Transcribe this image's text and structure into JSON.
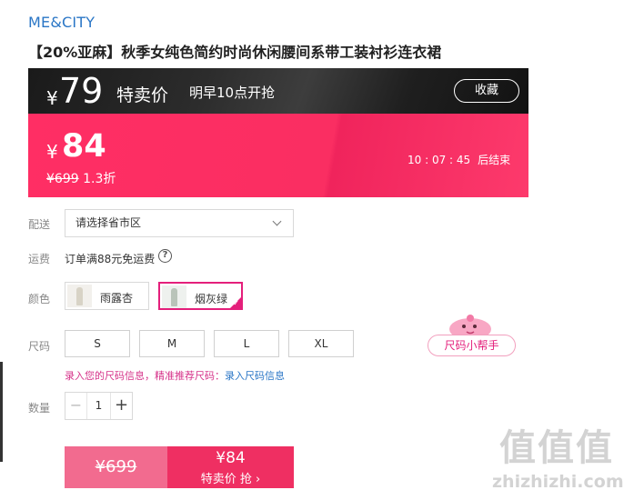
{
  "brand": "ME&CITY",
  "product_title": "【20%亚麻】秋季女纯色简约时尚休闲腰间系带工装衬衫连衣裙",
  "promo": {
    "upcoming_yen": "¥",
    "upcoming_price": "79",
    "upcoming_label": "特卖价",
    "upcoming_note": "明早10点开抢",
    "favorite_label": "收藏",
    "current_yen": "¥",
    "current_price": "84",
    "original_price": "¥699",
    "discount": "1.3折",
    "countdown": "10 : 07 : 45",
    "countdown_suffix": "后结束"
  },
  "delivery": {
    "label": "配送",
    "placeholder": "请选择省市区"
  },
  "shipping": {
    "label": "运费",
    "text": "订单满88元免运费",
    "help_icon": "?"
  },
  "color": {
    "label": "颜色",
    "options": [
      {
        "name": "雨露杏",
        "selected": false
      },
      {
        "name": "烟灰绿",
        "selected": true
      }
    ]
  },
  "size": {
    "label": "尺码",
    "options": [
      "S",
      "M",
      "L",
      "XL"
    ],
    "helper_label": "尺码小帮手",
    "hint_text": "录入您的尺码信息，精准推荐尺码：",
    "hint_link": "录入尺码信息"
  },
  "quantity": {
    "label": "数量",
    "value": "1",
    "minus": "−",
    "plus": "+"
  },
  "buttons": {
    "normal_price": "¥699",
    "special_price": "¥84",
    "special_label": "特卖价 抢 ›"
  },
  "watermark": {
    "chars": "值值值",
    "url": "zhizhizhi.com"
  },
  "colors": {
    "accent": "#e41f7b",
    "promo_red": "#ff2e64",
    "link_blue": "#2a76c6"
  }
}
